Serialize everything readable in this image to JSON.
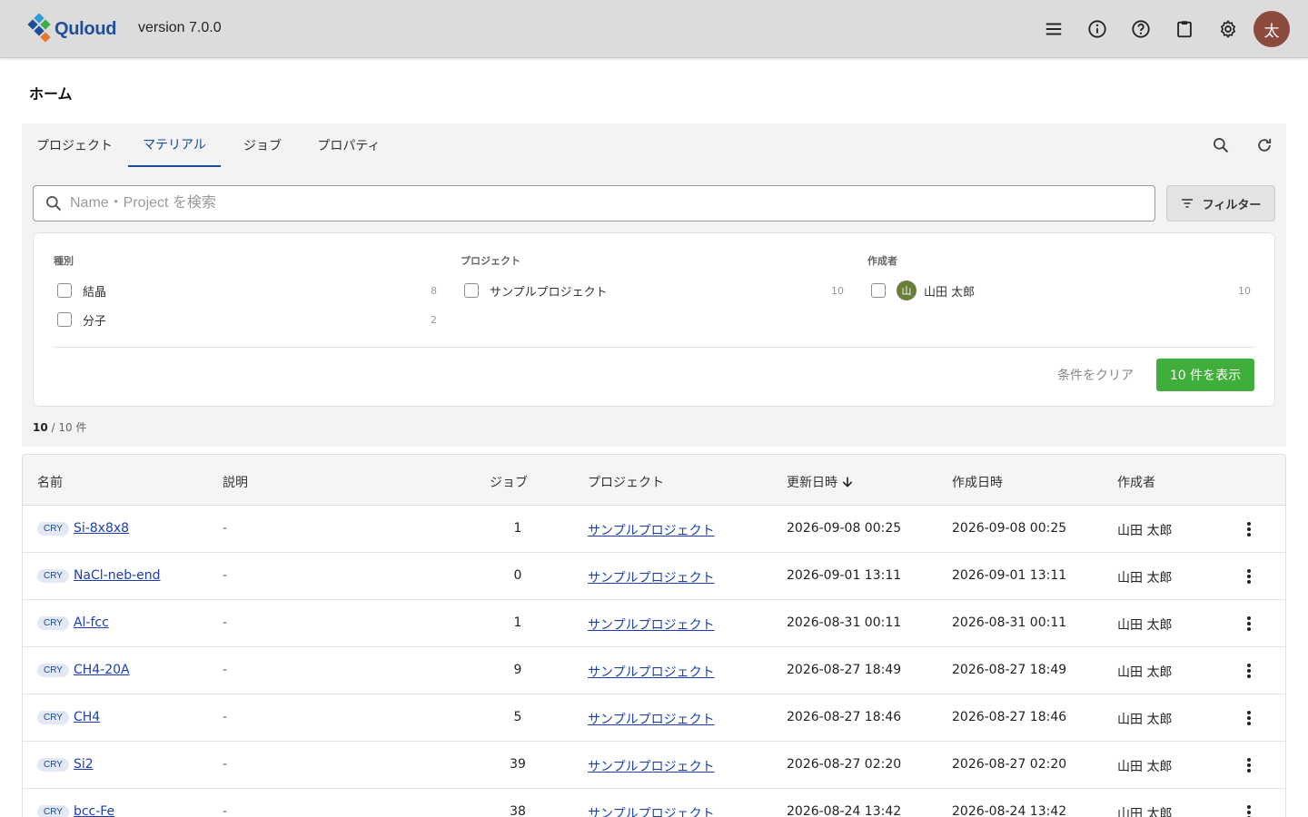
{
  "header": {
    "brand": "Quloud",
    "version": "version 7.0.0",
    "icons": [
      "menu-icon",
      "info-icon",
      "help-icon",
      "clipboard-icon",
      "gear-icon"
    ],
    "avatar_initial": "太",
    "colors": {
      "avatar": "#8b4a3c",
      "brand": "#1f4e9c"
    }
  },
  "page": {
    "title": "ホーム"
  },
  "tabs": [
    {
      "label": "プロジェクト",
      "active": false
    },
    {
      "label": "マテリアル",
      "active": true
    },
    {
      "label": "ジョブ",
      "active": false
    },
    {
      "label": "プロパティ",
      "active": false
    }
  ],
  "search": {
    "placeholder": "Name・Project を検索",
    "value": ""
  },
  "filter_button": {
    "label": "フィルター"
  },
  "filters": {
    "type": {
      "title": "種別",
      "items": [
        {
          "label": "結晶",
          "count": "8"
        },
        {
          "label": "分子",
          "count": "2"
        }
      ]
    },
    "project": {
      "title": "プロジェクト",
      "items": [
        {
          "label": "サンプルプロジェクト",
          "count": "10"
        }
      ]
    },
    "creator": {
      "title": "作成者",
      "items": [
        {
          "label": "山田 太郎",
          "initial": "山",
          "count": "10"
        }
      ]
    },
    "clear_label": "条件をクリア",
    "apply_label": "10 件を表示"
  },
  "result": {
    "shown": "10",
    "total": "/ 10 件"
  },
  "table": {
    "columns": {
      "name": "名前",
      "description": "説明",
      "jobs": "ジョブ",
      "project": "プロジェクト",
      "updated": "更新日時",
      "created": "作成日時",
      "creator": "作成者"
    },
    "rows": [
      {
        "tag": "CRY",
        "name": "Si-8x8x8",
        "description": "-",
        "jobs": "1",
        "project": "サンプルプロジェクト",
        "updated": "2026-09-08 00:25",
        "created": "2026-09-08 00:25",
        "creator": "山田 太郎"
      },
      {
        "tag": "CRY",
        "name": "NaCl-neb-end",
        "description": "-",
        "jobs": "0",
        "project": "サンプルプロジェクト",
        "updated": "2026-09-01 13:11",
        "created": "2026-09-01 13:11",
        "creator": "山田 太郎"
      },
      {
        "tag": "CRY",
        "name": "Al-fcc",
        "description": "-",
        "jobs": "1",
        "project": "サンプルプロジェクト",
        "updated": "2026-08-31 00:11",
        "created": "2026-08-31 00:11",
        "creator": "山田 太郎"
      },
      {
        "tag": "CRY",
        "name": "CH4-20A",
        "description": "-",
        "jobs": "9",
        "project": "サンプルプロジェクト",
        "updated": "2026-08-27 18:49",
        "created": "2026-08-27 18:49",
        "creator": "山田 太郎"
      },
      {
        "tag": "CRY",
        "name": "CH4",
        "description": "-",
        "jobs": "5",
        "project": "サンプルプロジェクト",
        "updated": "2026-08-27 18:46",
        "created": "2026-08-27 18:46",
        "creator": "山田 太郎"
      },
      {
        "tag": "CRY",
        "name": "Si2",
        "description": "-",
        "jobs": "39",
        "project": "サンプルプロジェクト",
        "updated": "2026-08-27 02:20",
        "created": "2026-08-27 02:20",
        "creator": "山田 太郎"
      },
      {
        "tag": "CRY",
        "name": "bcc-Fe",
        "description": "-",
        "jobs": "38",
        "project": "サンプルプロジェクト",
        "updated": "2026-08-24 13:42",
        "created": "2026-08-24 13:42",
        "creator": "山田 太郎"
      }
    ]
  }
}
